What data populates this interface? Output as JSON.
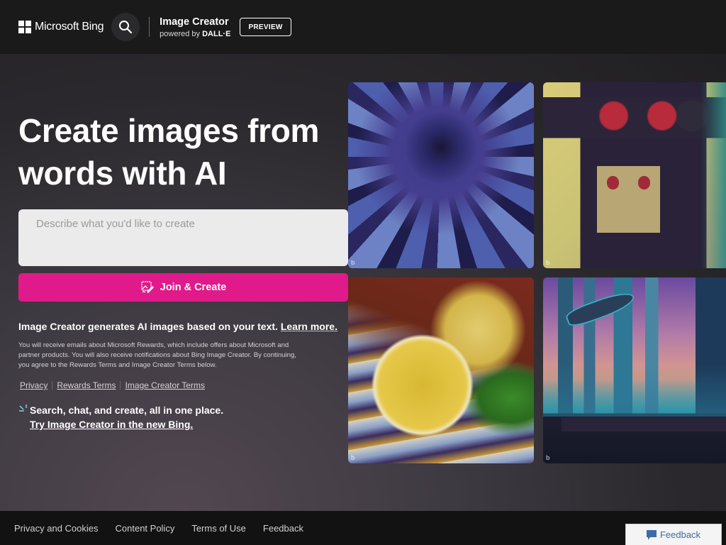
{
  "header": {
    "logo_text": "Microsoft Bing",
    "search_icon": "search-icon",
    "app_title": "Image Creator",
    "powered_by_prefix": "powered by",
    "powered_by_brand": "DALL·E",
    "badge": "PREVIEW"
  },
  "hero": {
    "title": "Create images from words with AI",
    "prompt_placeholder": "Describe what you'd like to create",
    "prompt_value": "",
    "create_button": "Join & Create",
    "create_icon": "image-edit-icon",
    "info_text": "Image Creator generates AI images based on your text.",
    "learn_more": "Learn more.",
    "disclaimer": "You will receive emails about Microsoft Rewards, which include offers about Microsoft and partner products. You will also receive notifications about Bing Image Creator. By continuing, you agree to the Rewards Terms and Image Creator Terms below.",
    "legal_links": [
      "Privacy",
      "Rewards Terms",
      "Image Creator Terms"
    ],
    "promo_line1": "Search, chat, and create, all in one place.",
    "promo_link": "Try Image Creator in the new Bing."
  },
  "gallery": {
    "items": [
      {
        "subject": "blue dahlia flower",
        "mark": "b"
      },
      {
        "subject": "retro boombox robot",
        "mark": "b"
      },
      {
        "subject": "surreal lemon painting",
        "mark": "b"
      },
      {
        "subject": "futuristic city skyline",
        "mark": "b"
      }
    ]
  },
  "footer": {
    "links": [
      "Privacy and Cookies",
      "Content Policy",
      "Terms of Use",
      "Feedback"
    ],
    "feedback_button": "Feedback"
  },
  "colors": {
    "accent": "#e01a8a",
    "header_bg": "#1b1a1b",
    "footer_bg": "#121212",
    "feedback_text": "#3c6ea6"
  }
}
